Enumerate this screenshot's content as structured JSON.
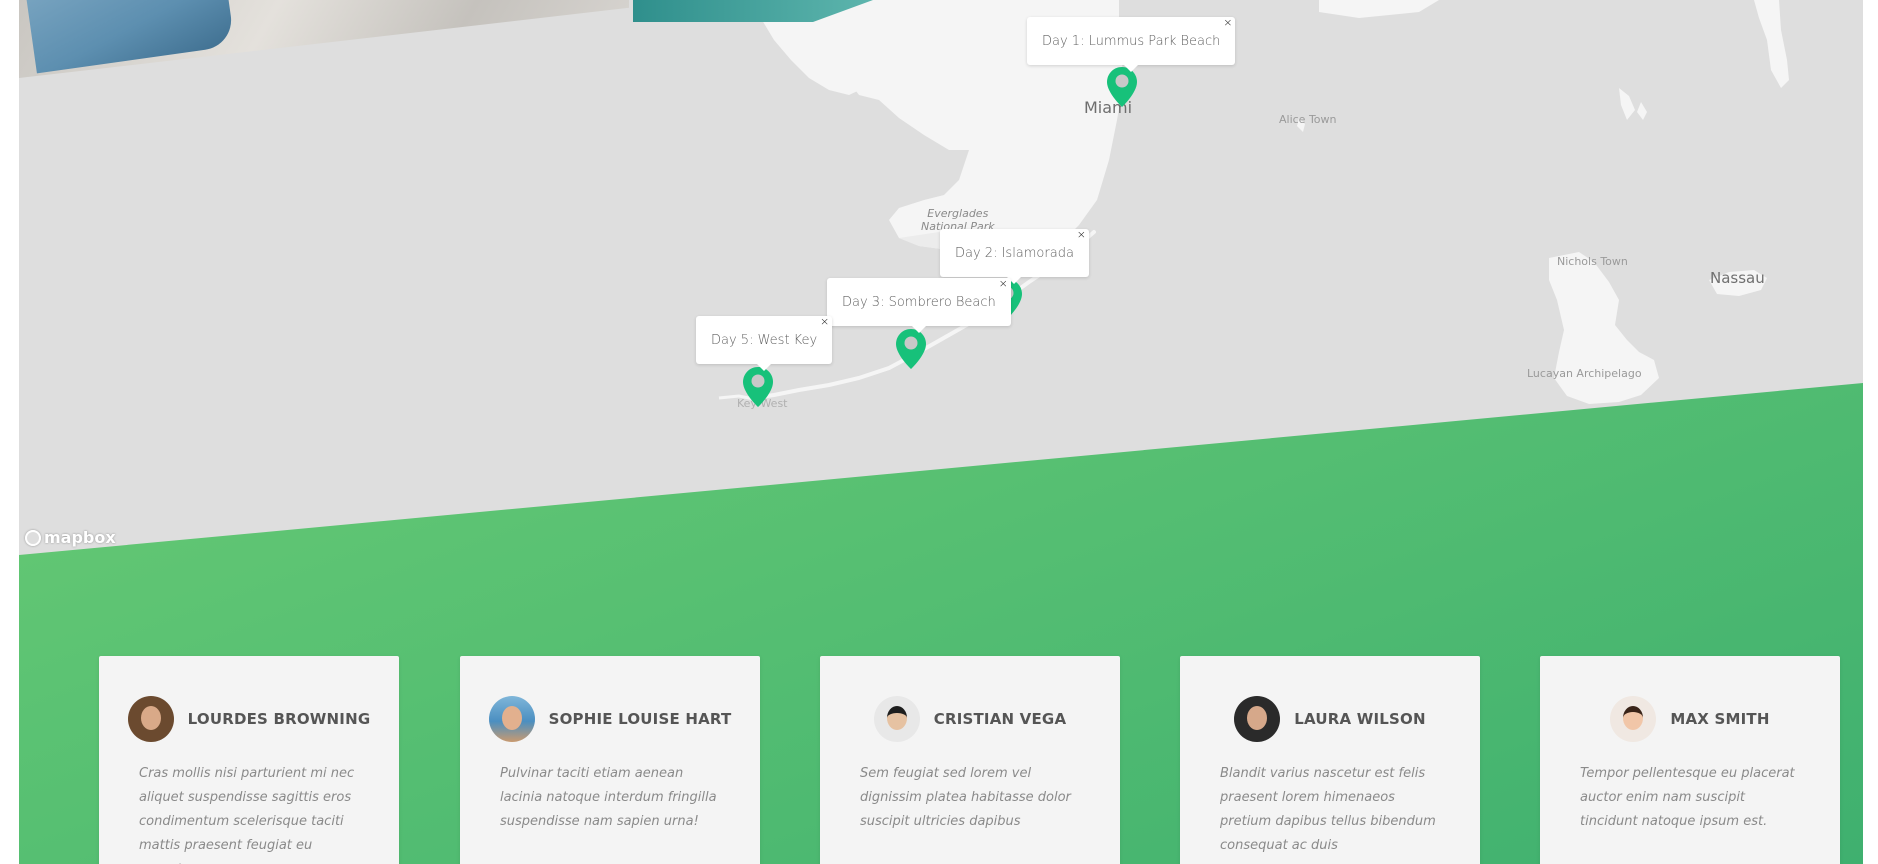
{
  "map": {
    "attribution_logo": "mapbox",
    "labels": {
      "miami": "Miami",
      "alice_town": "Alice Town",
      "everglades_line1": "Everglades",
      "everglades_line2": "National Park",
      "key_west": "Key West",
      "nichols_town": "Nichols Town",
      "nassau": "Nassau",
      "lucayan": "Lucayan Archipelago"
    },
    "marker_color": "#17c17a",
    "land_color": "#f5f5f5",
    "water_color": "#dedede",
    "popups": [
      {
        "label": "Day 1: Lummus Park Beach",
        "close": "×"
      },
      {
        "label": "Day 2: Islamorada",
        "close": "×"
      },
      {
        "label": "Day 3: Sombrero Beach",
        "close": "×"
      },
      {
        "label": "Day 5: West Key",
        "close": "×"
      }
    ]
  },
  "section": {
    "gradient_start": "#76d172",
    "gradient_end": "#3fb06f"
  },
  "testimonials": [
    {
      "name": "LOURDES BROWNING",
      "quote": "Cras mollis nisi parturient mi nec aliquet suspendisse sagittis eros condimentum scelerisque taciti mattis praesent feugiat eu nascetur a"
    },
    {
      "name": "SOPHIE LOUISE HART",
      "quote": "Pulvinar taciti etiam aenean lacinia natoque interdum fringilla suspendisse nam sapien urna!"
    },
    {
      "name": "CRISTIAN VEGA",
      "quote": "Sem feugiat sed lorem vel dignissim platea habitasse dolor suscipit ultricies dapibus"
    },
    {
      "name": "LAURA WILSON",
      "quote": "Blandit varius nascetur est felis praesent lorem himenaeos pretium dapibus tellus bibendum consequat ac duis"
    },
    {
      "name": "MAX SMITH",
      "quote": "Tempor pellentesque eu placerat auctor enim nam suscipit tincidunt natoque ipsum est."
    }
  ]
}
